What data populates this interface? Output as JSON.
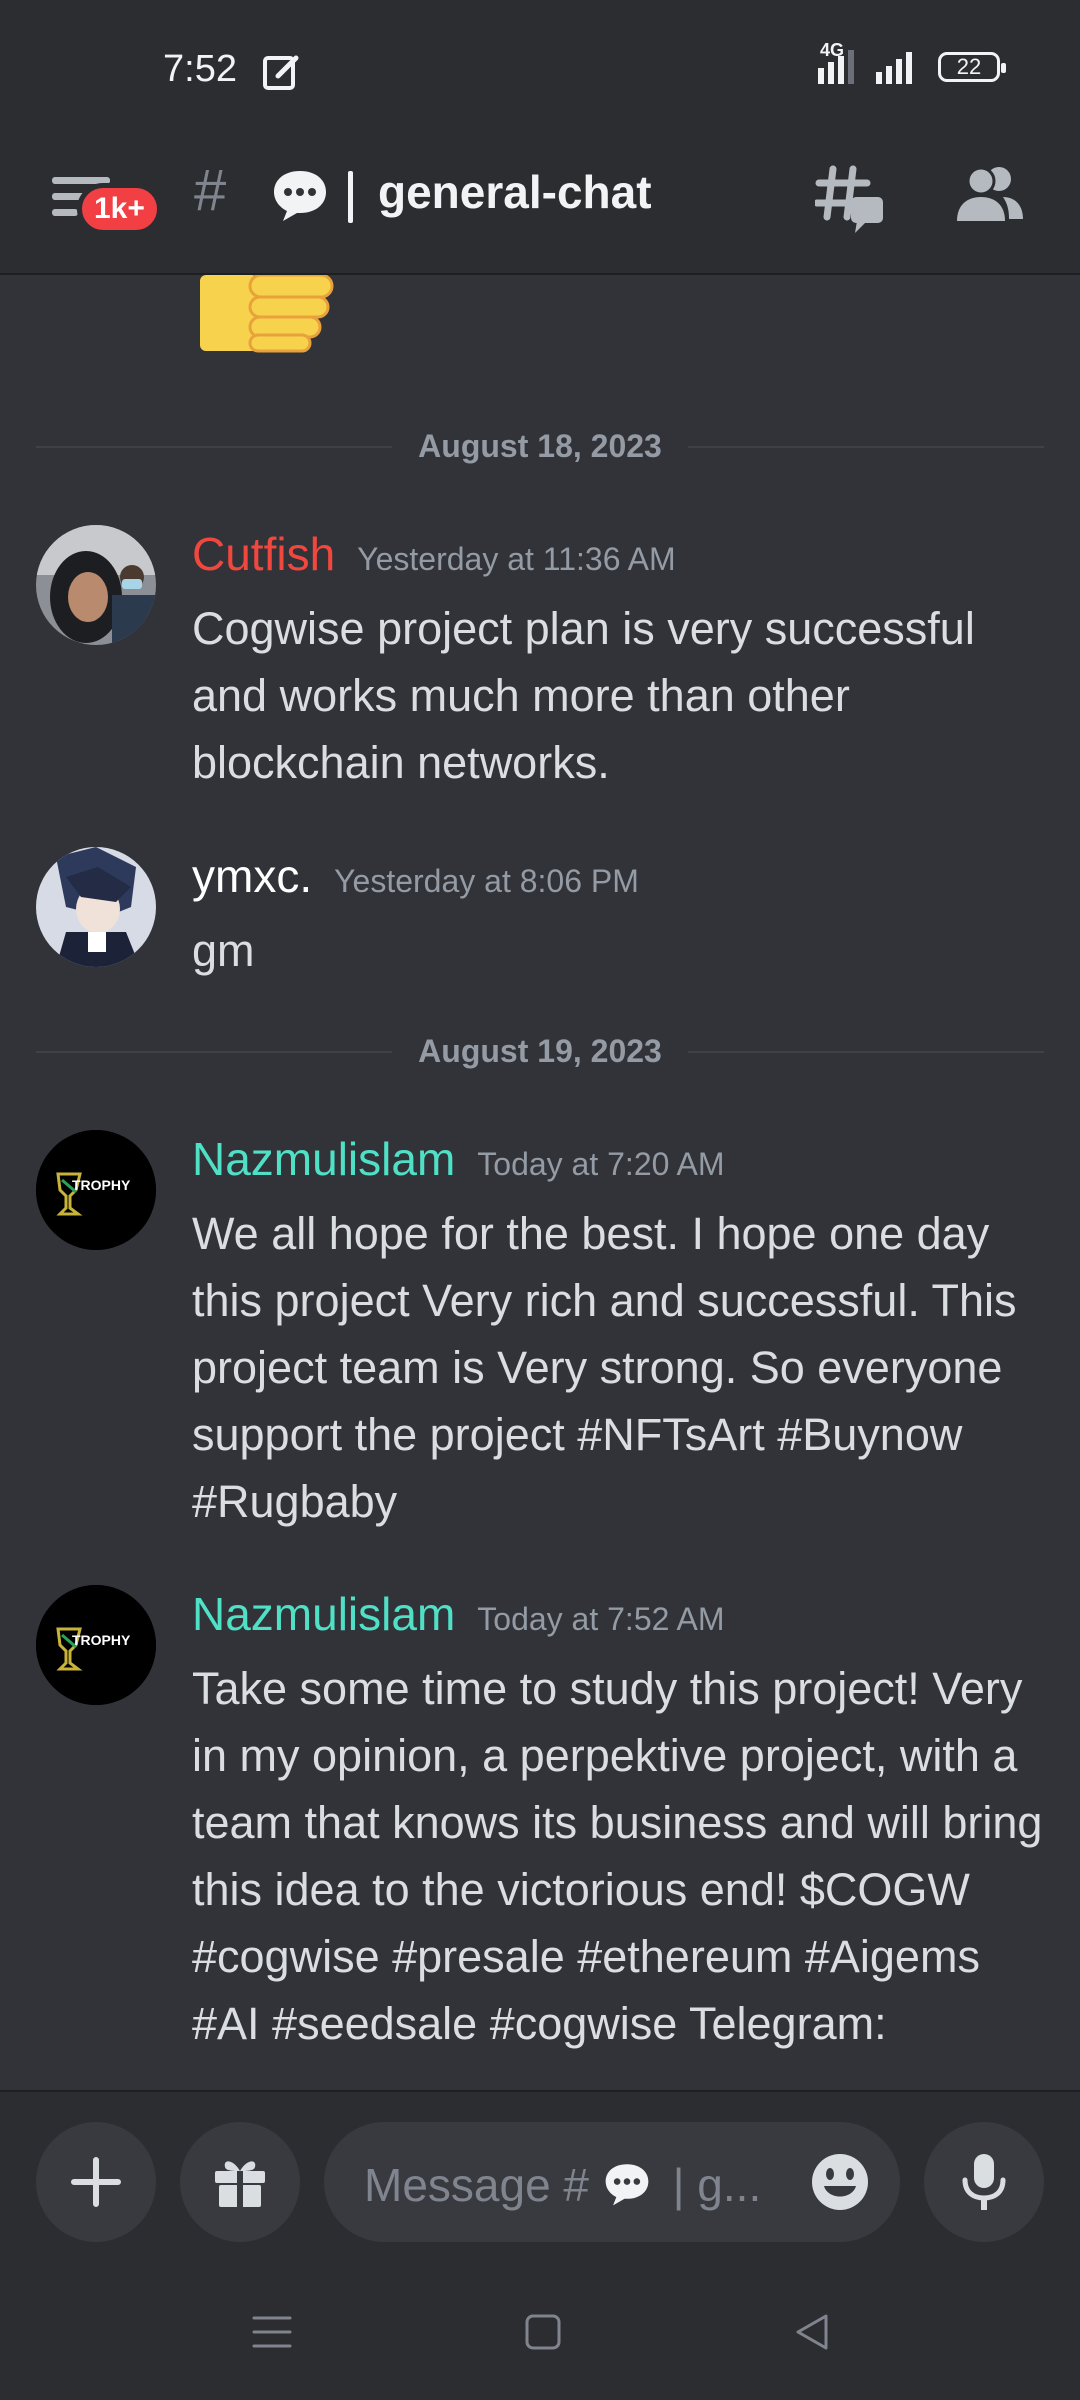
{
  "status_bar": {
    "time": "7:52",
    "network": "4G",
    "battery": "22"
  },
  "header": {
    "badge": "1k+",
    "hash": "#",
    "channel": "general-chat"
  },
  "chat": {
    "dividers": [
      "August 18, 2023",
      "August 19, 2023"
    ],
    "messages": [
      {
        "author": "Cutfish",
        "author_color": "#f0483e",
        "timestamp": "Yesterday at 11:36 AM",
        "text": "Cogwise project plan is very successful and works much more than other blockchain networks."
      },
      {
        "author": "ymxc.",
        "author_color": "#ffffff",
        "timestamp": "Yesterday at 8:06 PM",
        "text": "gm"
      },
      {
        "author": "Nazmulislam",
        "author_color": "#4fe0c6",
        "timestamp": "Today at 7:20 AM",
        "avatar_text": "TROPHY",
        "text": "We all hope for the best. I hope one day this project Very rich and successful. This project team is Very strong. So everyone support the project #NFTsArt #Buynow #Rugbaby"
      },
      {
        "author": "Nazmulislam",
        "author_color": "#4fe0c6",
        "timestamp": "Today at 7:52 AM",
        "avatar_text": "TROPHY",
        "text": "Take some time to study this project! Very in my opinion, a perpektive project, with a team that knows its business and will bring this idea to the victorious end! $COGW #cogwise #presale #ethereum #Aigems #AI #seedsale #cogwise Telegram:"
      }
    ]
  },
  "input": {
    "placeholder_prefix": "Message #",
    "placeholder_suffix": "| g..."
  },
  "icons": {
    "menu": "hamburger-menu-icon",
    "threads": "threads-icon",
    "members": "members-icon",
    "add": "plus-icon",
    "gift": "gift-icon",
    "emoji": "emoji-icon",
    "mic": "microphone-icon"
  }
}
